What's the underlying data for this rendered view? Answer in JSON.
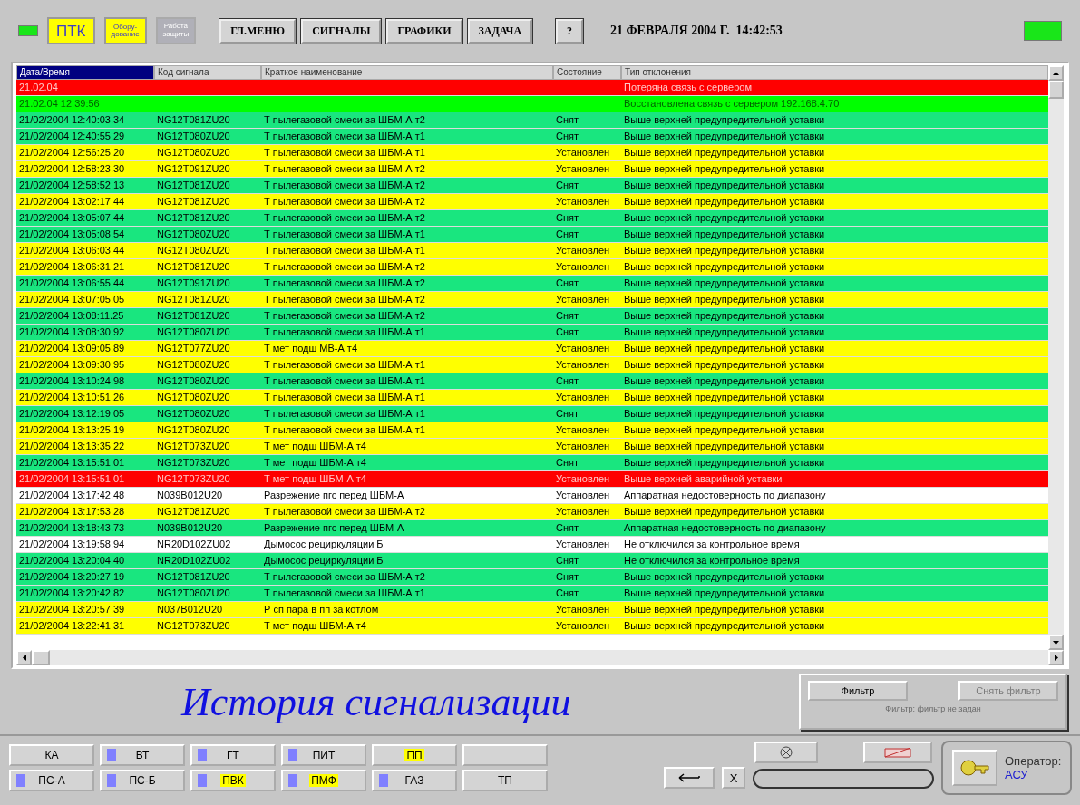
{
  "top_bar": {
    "indicator_left": {
      "on": true
    },
    "ptk": "ПТК",
    "equipment": "Обору-\nдование",
    "protection": {
      "label": "Работа\nзащиты",
      "disabled": true
    },
    "menu": [
      "ГЛ.МЕНЮ",
      "СИГНАЛЫ",
      "ГРАФИКИ",
      "ЗАДАЧА"
    ],
    "help": "?",
    "datetime": "21 ФЕВРАЛЯ 2004 Г.  14:42:53",
    "indicator_right": {
      "on": true
    }
  },
  "table": {
    "columns": [
      "Дата/Время",
      "Код сигнала",
      "Краткое наименование",
      "Состояние",
      "Тип отклонения"
    ],
    "rows": [
      {
        "color": "#ff0000",
        "cells": [
          "21.02.04",
          "",
          "",
          "",
          "Потеряна связь с сервером"
        ]
      },
      {
        "color": "#00ff00",
        "cells": [
          "21.02.04 12:39:56",
          "",
          "",
          "",
          "Восстановлена связь с сервером 192.168.4.70"
        ]
      },
      {
        "color": "#19e67f",
        "cells": [
          "21/02/2004  12:40:03.34",
          "NG12T081ZU20",
          "Т пылегазовой смеси за ШБМ-А т2",
          "Снят",
          "Выше верхней предупредительной уставки"
        ]
      },
      {
        "color": "#19e67f",
        "cells": [
          "21/02/2004  12:40:55.29",
          "NG12T080ZU20",
          "Т пылегазовой смеси за ШБМ-А т1",
          "Снят",
          "Выше верхней предупредительной уставки"
        ]
      },
      {
        "color": "#ffff00",
        "cells": [
          "21/02/2004  12:56:25.20",
          "NG12T080ZU20",
          "Т пылегазовой смеси за ШБМ-А т1",
          "Установлен",
          "Выше верхней предупредительной уставки"
        ]
      },
      {
        "color": "#ffff00",
        "cells": [
          "21/02/2004  12:58:23.30",
          "NG12T091ZU20",
          "Т пылегазовой смеси за ШБМ-А т2",
          "Установлен",
          "Выше верхней предупредительной уставки"
        ]
      },
      {
        "color": "#19e67f",
        "cells": [
          "21/02/2004  12:58:52.13",
          "NG12T081ZU20",
          "Т пылегазовой смеси за ШБМ-А т2",
          "Снят",
          "Выше верхней предупредительной уставки"
        ]
      },
      {
        "color": "#ffff00",
        "cells": [
          "21/02/2004  13:02:17.44",
          "NG12T081ZU20",
          "Т пылегазовой смеси за ШБМ-А т2",
          "Установлен",
          "Выше верхней предупредительной уставки"
        ]
      },
      {
        "color": "#19e67f",
        "cells": [
          "21/02/2004  13:05:07.44",
          "NG12T081ZU20",
          "Т пылегазовой смеси за ШБМ-А т2",
          "Снят",
          "Выше верхней предупредительной уставки"
        ]
      },
      {
        "color": "#19e67f",
        "cells": [
          "21/02/2004  13:05:08.54",
          "NG12T080ZU20",
          "Т пылегазовой смеси за ШБМ-А т1",
          "Снят",
          "Выше верхней предупредительной уставки"
        ]
      },
      {
        "color": "#ffff00",
        "cells": [
          "21/02/2004  13:06:03.44",
          "NG12T080ZU20",
          "Т пылегазовой смеси за ШБМ-А т1",
          "Установлен",
          "Выше верхней предупредительной уставки"
        ]
      },
      {
        "color": "#ffff00",
        "cells": [
          "21/02/2004  13:06:31.21",
          "NG12T081ZU20",
          "Т пылегазовой смеси за ШБМ-А т2",
          "Установлен",
          "Выше верхней предупредительной уставки"
        ]
      },
      {
        "color": "#19e67f",
        "cells": [
          "21/02/2004  13:06:55.44",
          "NG12T091ZU20",
          "Т пылегазовой смеси за ШБМ-А т2",
          "Снят",
          "Выше верхней предупредительной уставки"
        ]
      },
      {
        "color": "#ffff00",
        "cells": [
          "21/02/2004  13:07:05.05",
          "NG12T081ZU20",
          "Т пылегазовой смеси за ШБМ-А т2",
          "Установлен",
          "Выше верхней предупредительной уставки"
        ]
      },
      {
        "color": "#19e67f",
        "cells": [
          "21/02/2004  13:08:11.25",
          "NG12T081ZU20",
          "Т пылегазовой смеси за ШБМ-А т2",
          "Снят",
          "Выше верхней предупредительной уставки"
        ]
      },
      {
        "color": "#19e67f",
        "cells": [
          "21/02/2004  13:08:30.92",
          "NG12T080ZU20",
          "Т пылегазовой смеси за ШБМ-А т1",
          "Снят",
          "Выше верхней предупредительной уставки"
        ]
      },
      {
        "color": "#ffff00",
        "cells": [
          "21/02/2004  13:09:05.89",
          "NG12T077ZU20",
          "Т мет подш МВ-А т4",
          "Установлен",
          "Выше верхней предупредительной уставки"
        ]
      },
      {
        "color": "#ffff00",
        "cells": [
          "21/02/2004  13:09:30.95",
          "NG12T080ZU20",
          "Т пылегазовой смеси за ШБМ-А т1",
          "Установлен",
          "Выше верхней предупредительной уставки"
        ]
      },
      {
        "color": "#19e67f",
        "cells": [
          "21/02/2004  13:10:24.98",
          "NG12T080ZU20",
          "Т пылегазовой смеси за ШБМ-А т1",
          "Снят",
          "Выше верхней предупредительной уставки"
        ]
      },
      {
        "color": "#ffff00",
        "cells": [
          "21/02/2004  13:10:51.26",
          "NG12T080ZU20",
          "Т пылегазовой смеси за ШБМ-А т1",
          "Установлен",
          "Выше верхней предупредительной уставки"
        ]
      },
      {
        "color": "#19e67f",
        "cells": [
          "21/02/2004  13:12:19.05",
          "NG12T080ZU20",
          "Т пылегазовой смеси за ШБМ-А т1",
          "Снят",
          "Выше верхней предупредительной уставки"
        ]
      },
      {
        "color": "#ffff00",
        "cells": [
          "21/02/2004  13:13:25.19",
          "NG12T080ZU20",
          "Т пылегазовой смеси за ШБМ-А т1",
          "Установлен",
          "Выше верхней предупредительной уставки"
        ]
      },
      {
        "color": "#ffff00",
        "cells": [
          "21/02/2004  13:13:35.22",
          "NG12T073ZU20",
          "Т мет подш ШБМ-А т4",
          "Установлен",
          "Выше верхней предупредительной уставки"
        ]
      },
      {
        "color": "#19e67f",
        "cells": [
          "21/02/2004  13:15:51.01",
          "NG12T073ZU20",
          "Т мет подш ШБМ-А т4",
          "Снят",
          "Выше верхней предупредительной уставки"
        ]
      },
      {
        "color": "#ff0000",
        "cells": [
          "21/02/2004  13:15:51.01",
          "NG12T073ZU20",
          "Т мет подш ШБМ-А т4",
          "Установлен",
          "Выше верхней аварийной уставки"
        ]
      },
      {
        "color": "#ffffff",
        "cells": [
          "21/02/2004  13:17:42.48",
          "N039B012U20",
          "Разрежение пгс перед ШБМ-А",
          "Установлен",
          "Аппаратная недостоверность по диапазону"
        ]
      },
      {
        "color": "#ffff00",
        "cells": [
          "21/02/2004  13:17:53.28",
          "NG12T081ZU20",
          "Т пылегазовой смеси за ШБМ-А т2",
          "Установлен",
          "Выше верхней предупредительной уставки"
        ]
      },
      {
        "color": "#19e67f",
        "cells": [
          "21/02/2004  13:18:43.73",
          "N039B012U20",
          "Разрежение пгс перед ШБМ-А",
          "Снят",
          "Аппаратная недостоверность по диапазону"
        ]
      },
      {
        "color": "#ffffff",
        "cells": [
          "21/02/2004  13:19:58.94",
          "NR20D102ZU02",
          "Дымосос рециркуляции Б",
          "Установлен",
          "Не отключился за контрольное время"
        ]
      },
      {
        "color": "#19e67f",
        "cells": [
          "21/02/2004  13:20:04.40",
          "NR20D102ZU02",
          "Дымосос рециркуляции Б",
          "Снят",
          "Не отключился за контрольное время"
        ]
      },
      {
        "color": "#19e67f",
        "cells": [
          "21/02/2004  13:20:27.19",
          "NG12T081ZU20",
          "Т пылегазовой смеси за ШБМ-А т2",
          "Снят",
          "Выше верхней предупредительной уставки"
        ]
      },
      {
        "color": "#19e67f",
        "cells": [
          "21/02/2004  13:20:42.82",
          "NG12T080ZU20",
          "Т пылегазовой смеси за ШБМ-А т1",
          "Снят",
          "Выше верхней предупредительной уставки"
        ]
      },
      {
        "color": "#ffff00",
        "cells": [
          "21/02/2004  13:20:57.39",
          "N037B012U20",
          "Р сп пара в пп за котлом",
          "Установлен",
          "Выше верхней предупредительной уставки"
        ]
      },
      {
        "color": "#ffff00",
        "cells": [
          "21/02/2004  13:22:41.31",
          "NG12T073ZU20",
          "Т мет подш ШБМ-А т4",
          "Установлен",
          "Выше верхней предупредительной уставки"
        ]
      }
    ]
  },
  "title": "История сигнализации",
  "filter": {
    "button": "Фильтр",
    "clear": {
      "label": "Снять фильтр",
      "disabled": true
    },
    "status": "Фильтр: фильтр не задан"
  },
  "systems": [
    {
      "label": "КА",
      "marked": false,
      "highlighted": false
    },
    {
      "label": "ВТ",
      "marked": true,
      "highlighted": false
    },
    {
      "label": "ГТ",
      "marked": true,
      "highlighted": false
    },
    {
      "label": "ПИТ",
      "marked": true,
      "highlighted": false
    },
    {
      "label": "ПП",
      "marked": false,
      "highlighted": true
    },
    {
      "marked": false
    },
    {
      "label": "ПС-А",
      "marked": true,
      "highlighted": false
    },
    {
      "label": "ПС-Б",
      "marked": true,
      "highlighted": false
    },
    {
      "label": "ПВК",
      "marked": true,
      "highlighted": true
    },
    {
      "label": "ПМФ",
      "marked": true,
      "highlighted": true
    },
    {
      "label": "ГАЗ",
      "marked": true,
      "highlighted": false
    },
    {
      "label": "ТП",
      "marked": false,
      "highlighted": false
    }
  ],
  "controls": {
    "close": "X"
  },
  "operator": {
    "label": "Оператор:",
    "name": "АСУ"
  }
}
